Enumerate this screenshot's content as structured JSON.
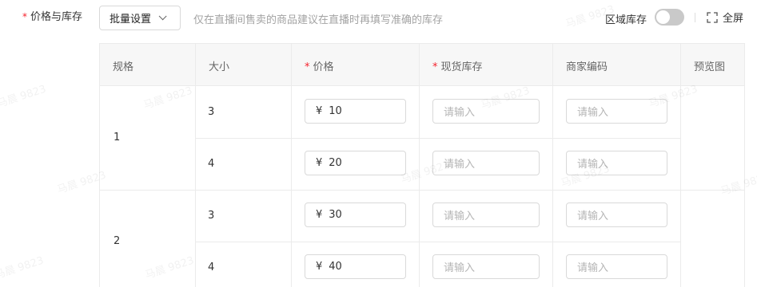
{
  "form": {
    "required_mark": "*",
    "label": "价格与库存",
    "batch_button": "批量设置",
    "hint": "仅在直播间售卖的商品建议在直播时再填写准确的库存",
    "region_stock_label": "区域库存",
    "region_stock_enabled": false,
    "fullscreen_label": "全屏"
  },
  "table": {
    "headers": {
      "spec": "规格",
      "size": "大小",
      "price": "价格",
      "stock": "现货库存",
      "merchant_code": "商家编码",
      "preview": "预览图"
    },
    "currency": "¥",
    "placeholder": "请输入",
    "groups": [
      {
        "spec": "1",
        "rows": [
          {
            "size": "3",
            "price": "10"
          },
          {
            "size": "4",
            "price": "20"
          }
        ]
      },
      {
        "spec": "2",
        "rows": [
          {
            "size": "3",
            "price": "30"
          },
          {
            "size": "4",
            "price": "40"
          }
        ]
      }
    ]
  },
  "watermark": "马晨 9823",
  "icons": {
    "dropdown": "chevron-down-icon",
    "fullscreen": "fullscreen-icon"
  }
}
